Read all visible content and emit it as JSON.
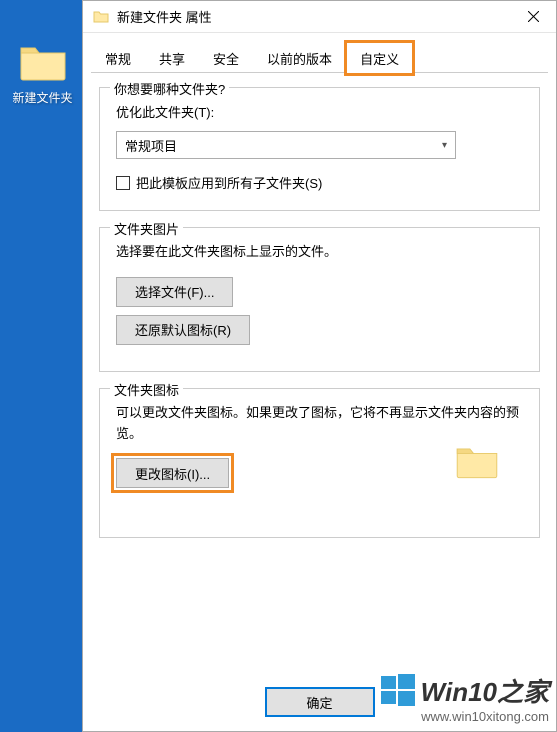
{
  "desktop": {
    "folder_label": "新建文件夹"
  },
  "dialog": {
    "title": "新建文件夹 属性",
    "tabs": {
      "general": "常规",
      "sharing": "共享",
      "security": "安全",
      "previous": "以前的版本",
      "customize": "自定义"
    },
    "group_type": {
      "legend": "你想要哪种文件夹?",
      "optimize_label": "优化此文件夹(T):",
      "select_value": "常规项目",
      "checkbox_label": "把此模板应用到所有子文件夹(S)"
    },
    "group_picture": {
      "legend": "文件夹图片",
      "desc": "选择要在此文件夹图标上显示的文件。",
      "choose_btn": "选择文件(F)...",
      "restore_btn": "还原默认图标(R)"
    },
    "group_icon": {
      "legend": "文件夹图标",
      "desc": "可以更改文件夹图标。如果更改了图标，它将不再显示文件夹内容的预览。",
      "change_btn": "更改图标(I)..."
    },
    "footer": {
      "ok": "确定"
    }
  },
  "watermark": {
    "brand": "Win10之家",
    "url": "www.win10xitong.com"
  }
}
